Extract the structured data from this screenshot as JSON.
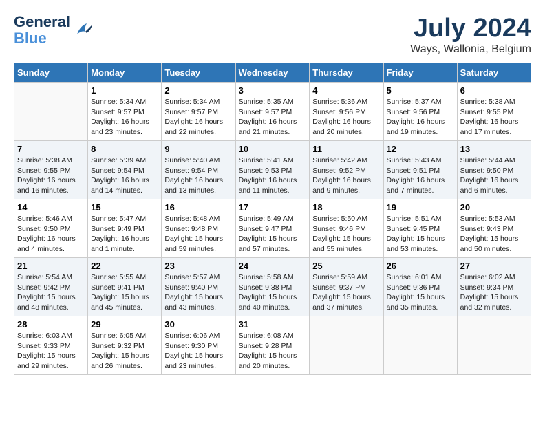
{
  "header": {
    "logo_line1": "General",
    "logo_line2": "Blue",
    "month_year": "July 2024",
    "location": "Ways, Wallonia, Belgium"
  },
  "weekdays": [
    "Sunday",
    "Monday",
    "Tuesday",
    "Wednesday",
    "Thursday",
    "Friday",
    "Saturday"
  ],
  "weeks": [
    [
      {
        "day": "",
        "info": ""
      },
      {
        "day": "1",
        "info": "Sunrise: 5:34 AM\nSunset: 9:57 PM\nDaylight: 16 hours\nand 23 minutes."
      },
      {
        "day": "2",
        "info": "Sunrise: 5:34 AM\nSunset: 9:57 PM\nDaylight: 16 hours\nand 22 minutes."
      },
      {
        "day": "3",
        "info": "Sunrise: 5:35 AM\nSunset: 9:57 PM\nDaylight: 16 hours\nand 21 minutes."
      },
      {
        "day": "4",
        "info": "Sunrise: 5:36 AM\nSunset: 9:56 PM\nDaylight: 16 hours\nand 20 minutes."
      },
      {
        "day": "5",
        "info": "Sunrise: 5:37 AM\nSunset: 9:56 PM\nDaylight: 16 hours\nand 19 minutes."
      },
      {
        "day": "6",
        "info": "Sunrise: 5:38 AM\nSunset: 9:55 PM\nDaylight: 16 hours\nand 17 minutes."
      }
    ],
    [
      {
        "day": "7",
        "info": "Sunrise: 5:38 AM\nSunset: 9:55 PM\nDaylight: 16 hours\nand 16 minutes."
      },
      {
        "day": "8",
        "info": "Sunrise: 5:39 AM\nSunset: 9:54 PM\nDaylight: 16 hours\nand 14 minutes."
      },
      {
        "day": "9",
        "info": "Sunrise: 5:40 AM\nSunset: 9:54 PM\nDaylight: 16 hours\nand 13 minutes."
      },
      {
        "day": "10",
        "info": "Sunrise: 5:41 AM\nSunset: 9:53 PM\nDaylight: 16 hours\nand 11 minutes."
      },
      {
        "day": "11",
        "info": "Sunrise: 5:42 AM\nSunset: 9:52 PM\nDaylight: 16 hours\nand 9 minutes."
      },
      {
        "day": "12",
        "info": "Sunrise: 5:43 AM\nSunset: 9:51 PM\nDaylight: 16 hours\nand 7 minutes."
      },
      {
        "day": "13",
        "info": "Sunrise: 5:44 AM\nSunset: 9:50 PM\nDaylight: 16 hours\nand 6 minutes."
      }
    ],
    [
      {
        "day": "14",
        "info": "Sunrise: 5:46 AM\nSunset: 9:50 PM\nDaylight: 16 hours\nand 4 minutes."
      },
      {
        "day": "15",
        "info": "Sunrise: 5:47 AM\nSunset: 9:49 PM\nDaylight: 16 hours\nand 1 minute."
      },
      {
        "day": "16",
        "info": "Sunrise: 5:48 AM\nSunset: 9:48 PM\nDaylight: 15 hours\nand 59 minutes."
      },
      {
        "day": "17",
        "info": "Sunrise: 5:49 AM\nSunset: 9:47 PM\nDaylight: 15 hours\nand 57 minutes."
      },
      {
        "day": "18",
        "info": "Sunrise: 5:50 AM\nSunset: 9:46 PM\nDaylight: 15 hours\nand 55 minutes."
      },
      {
        "day": "19",
        "info": "Sunrise: 5:51 AM\nSunset: 9:45 PM\nDaylight: 15 hours\nand 53 minutes."
      },
      {
        "day": "20",
        "info": "Sunrise: 5:53 AM\nSunset: 9:43 PM\nDaylight: 15 hours\nand 50 minutes."
      }
    ],
    [
      {
        "day": "21",
        "info": "Sunrise: 5:54 AM\nSunset: 9:42 PM\nDaylight: 15 hours\nand 48 minutes."
      },
      {
        "day": "22",
        "info": "Sunrise: 5:55 AM\nSunset: 9:41 PM\nDaylight: 15 hours\nand 45 minutes."
      },
      {
        "day": "23",
        "info": "Sunrise: 5:57 AM\nSunset: 9:40 PM\nDaylight: 15 hours\nand 43 minutes."
      },
      {
        "day": "24",
        "info": "Sunrise: 5:58 AM\nSunset: 9:38 PM\nDaylight: 15 hours\nand 40 minutes."
      },
      {
        "day": "25",
        "info": "Sunrise: 5:59 AM\nSunset: 9:37 PM\nDaylight: 15 hours\nand 37 minutes."
      },
      {
        "day": "26",
        "info": "Sunrise: 6:01 AM\nSunset: 9:36 PM\nDaylight: 15 hours\nand 35 minutes."
      },
      {
        "day": "27",
        "info": "Sunrise: 6:02 AM\nSunset: 9:34 PM\nDaylight: 15 hours\nand 32 minutes."
      }
    ],
    [
      {
        "day": "28",
        "info": "Sunrise: 6:03 AM\nSunset: 9:33 PM\nDaylight: 15 hours\nand 29 minutes."
      },
      {
        "day": "29",
        "info": "Sunrise: 6:05 AM\nSunset: 9:32 PM\nDaylight: 15 hours\nand 26 minutes."
      },
      {
        "day": "30",
        "info": "Sunrise: 6:06 AM\nSunset: 9:30 PM\nDaylight: 15 hours\nand 23 minutes."
      },
      {
        "day": "31",
        "info": "Sunrise: 6:08 AM\nSunset: 9:28 PM\nDaylight: 15 hours\nand 20 minutes."
      },
      {
        "day": "",
        "info": ""
      },
      {
        "day": "",
        "info": ""
      },
      {
        "day": "",
        "info": ""
      }
    ]
  ]
}
